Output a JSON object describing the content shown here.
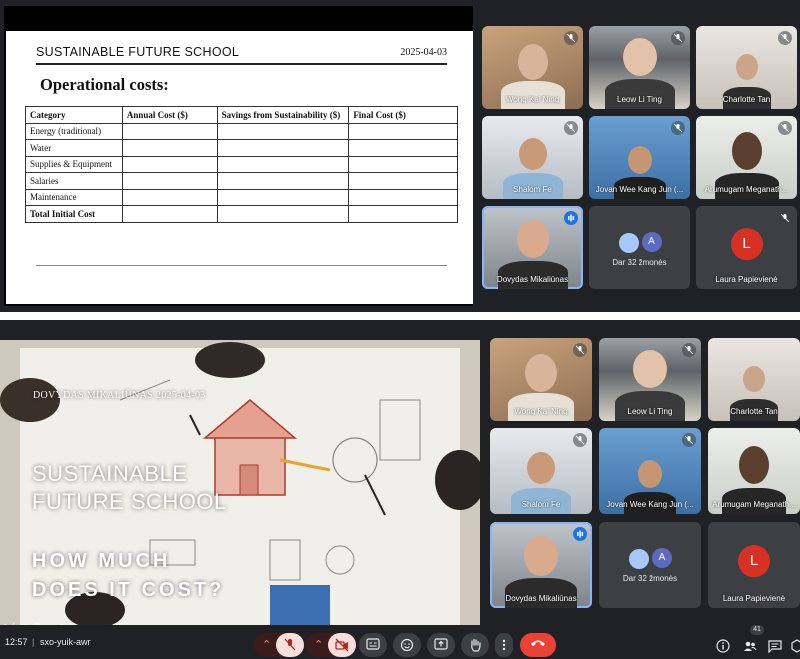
{
  "slide1": {
    "school": "SUSTAINABLE FUTURE SCHOOL",
    "date": "2025-04-03",
    "title": "Operational costs:",
    "table": {
      "headers": [
        "Category",
        "Annual Cost ($)",
        "Savings from Sustainability ($)",
        "Final Cost ($)"
      ],
      "rows": [
        "Energy (traditional)",
        "Water",
        "Supplies & Equipment",
        "Salaries",
        "Maintenance",
        "Total Initial Cost"
      ]
    }
  },
  "participants_top": [
    {
      "name": "Wong Kai Ning"
    },
    {
      "name": "Leow Li Ting"
    },
    {
      "name": "Charlotte Tan"
    },
    {
      "name": "Shalom Fe"
    },
    {
      "name": "Jovan Wee Kang Jun (..."
    },
    {
      "name": "Arumugam Meganath..."
    },
    {
      "name": "Dovydas Mikaliūnas"
    },
    {
      "name": "Dar 32 žmonės",
      "avatar_letter": "A"
    },
    {
      "name": "Laura Papievienė",
      "avatar_letter": "L"
    }
  ],
  "slide2": {
    "meta": "DOVYDAS MIKALIŪNAS  2025-04-03",
    "title_line1": "SUSTAINABLE",
    "title_line2": "FUTURE SCHOOL",
    "question_line1": "HOW MUCH",
    "question_line2": "DOES IT COST?",
    "toolbar": "◂ ⁄ ▭ ⊞ ⋯ ▸"
  },
  "participants_bottom": [
    {
      "name": "Wong Kai Ning"
    },
    {
      "name": "Leow Li Ting"
    },
    {
      "name": "Charlotte Tan"
    },
    {
      "name": "Shalom Fe"
    },
    {
      "name": "Jovan Wee Kang Jun (..."
    },
    {
      "name": "Arumugam Meganath..."
    },
    {
      "name": "Dovydas Mikaliūnas"
    },
    {
      "name": "Dar 32 žmonės",
      "avatar_letter": "A"
    },
    {
      "name": "Laura Papievienė",
      "avatar_letter": "L"
    }
  ],
  "bottom_bar": {
    "time": "12:57",
    "separator": "|",
    "meeting_code": "sxo-yuik-awr",
    "people_count": "41",
    "icons": [
      "chevron-up-icon",
      "mic-off-icon",
      "camera-off-icon",
      "captions-icon",
      "emoji-icon",
      "present-icon",
      "raise-hand-icon",
      "more-icon",
      "hangup-icon",
      "info-icon",
      "people-icon",
      "chat-icon",
      "activities-icon"
    ],
    "colors": {
      "hangup": "#ea4335",
      "mic_off_bg": "#f9dedc",
      "active_speaker": "#1a73e8"
    }
  }
}
